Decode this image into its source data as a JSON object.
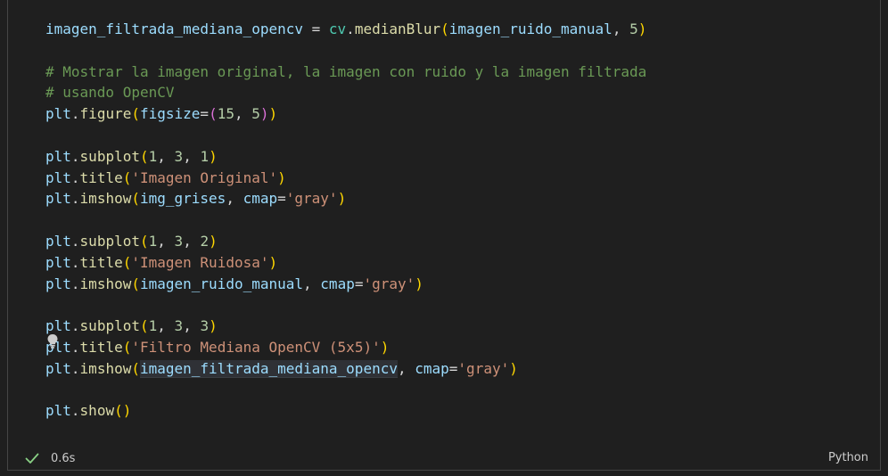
{
  "code_lines": [
    "imagen_filtrada_mediana_opencv = cv.medianBlur(imagen_ruido_manual, 5)",
    "",
    "# Mostrar la imagen original, la imagen con ruido y la imagen filtrada",
    "# usando OpenCV",
    "plt.figure(figsize=(15, 5))",
    "",
    "plt.subplot(1, 3, 1)",
    "plt.title('Imagen Original')",
    "plt.imshow(img_grises, cmap='gray')",
    "",
    "plt.subplot(1, 3, 2)",
    "plt.title('Imagen Ruidosa')",
    "plt.imshow(imagen_ruido_manual, cmap='gray')",
    "",
    "plt.subplot(1, 3, 3)",
    "plt.title('Filtro Mediana OpenCV (5x5)')",
    "plt.imshow(imagen_filtrada_mediana_opencv, cmap='gray')",
    "",
    "plt.show()"
  ],
  "status": {
    "state_icon": "check-icon",
    "duration": "0.6s",
    "success_color": "#89d185"
  },
  "language": "Python",
  "colors": {
    "background": "#1f1f1f",
    "variable": "#9cdcfe",
    "function": "#dcdcaa",
    "string": "#ce9178",
    "number": "#b5cea8",
    "comment": "#6a9955",
    "bracket_1": "#ffd700",
    "bracket_2": "#da70d6"
  }
}
